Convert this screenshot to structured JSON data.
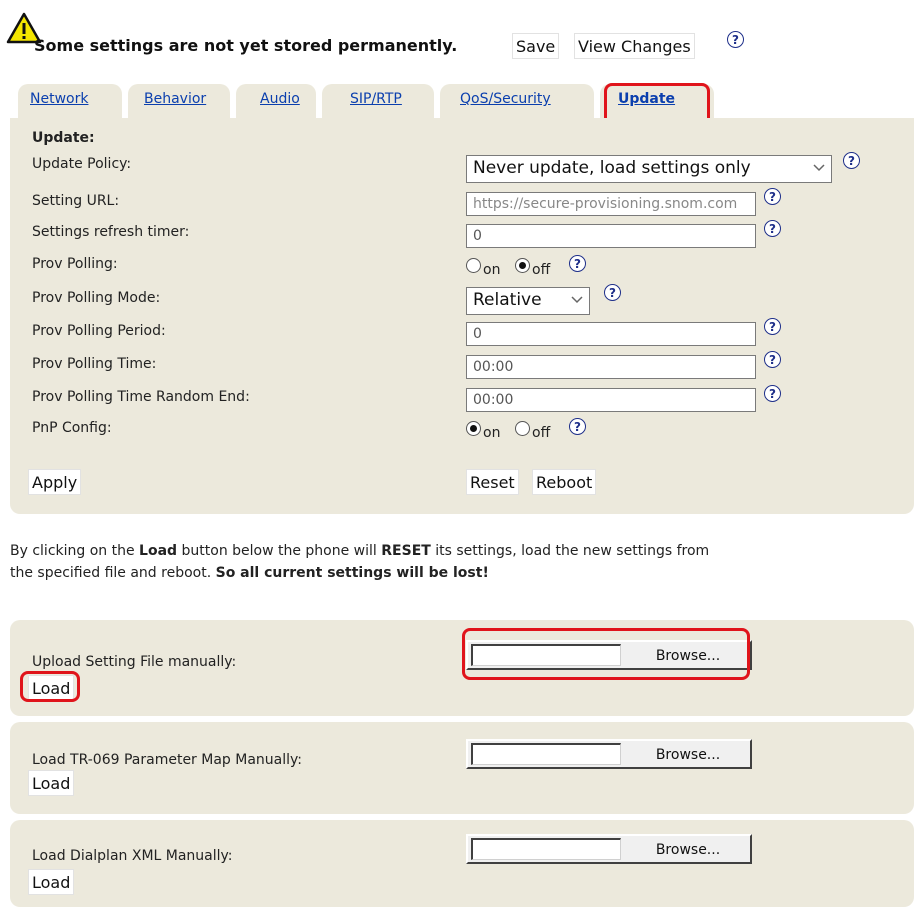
{
  "warning": {
    "icon": "warning-triangle-icon",
    "message": "Some settings are not yet stored permanently.",
    "save_label": "Save",
    "view_changes_label": "View Changes"
  },
  "help_glyph": "?",
  "tabs": [
    {
      "label": "Network"
    },
    {
      "label": "Behavior"
    },
    {
      "label": "Audio"
    },
    {
      "label": "SIP/RTP"
    },
    {
      "label": "QoS/Security"
    },
    {
      "label": "Update",
      "active": true
    }
  ],
  "update_panel": {
    "heading": "Update:",
    "update_policy": {
      "label": "Update Policy:",
      "value": "Never update, load settings only"
    },
    "setting_url": {
      "label": "Setting URL:",
      "value": "https://secure-provisioning.snom.com"
    },
    "refresh_timer": {
      "label": "Settings refresh timer:",
      "value": "0"
    },
    "prov_polling": {
      "label": "Prov Polling:",
      "on_label": "on",
      "off_label": "off",
      "selected": "off"
    },
    "prov_polling_mode": {
      "label": "Prov Polling Mode:",
      "value": "Relative"
    },
    "prov_polling_period": {
      "label": "Prov Polling Period:",
      "value": "0"
    },
    "prov_polling_time": {
      "label": "Prov Polling Time:",
      "value": "00:00"
    },
    "prov_polling_time_random_end": {
      "label": "Prov Polling Time Random End:",
      "value": "00:00"
    },
    "pnp_config": {
      "label": "PnP Config:",
      "on_label": "on",
      "off_label": "off",
      "selected": "on"
    },
    "apply_label": "Apply",
    "reset_label": "Reset",
    "reboot_label": "Reboot"
  },
  "info": {
    "p1": "By clicking on the ",
    "b1": "Load",
    "p2": " button below the phone will ",
    "b2": "RESET",
    "p3": " its settings, load the new settings from",
    "p4": "the specified file and reboot. ",
    "b3": "So all current settings will be lost!"
  },
  "uploads": [
    {
      "label": "Upload Setting File manually:",
      "browse_label": "Browse...",
      "load_label": "Load"
    },
    {
      "label": "Load TR-069 Parameter Map Manually:",
      "browse_label": "Browse...",
      "load_label": "Load"
    },
    {
      "label": "Load Dialplan XML Manually:",
      "browse_label": "Browse...",
      "load_label": "Load"
    }
  ],
  "colors": {
    "panel": "#ece9dc",
    "link": "#0b3fae",
    "highlight": "#e0141b",
    "help": "#1e2f8a"
  }
}
